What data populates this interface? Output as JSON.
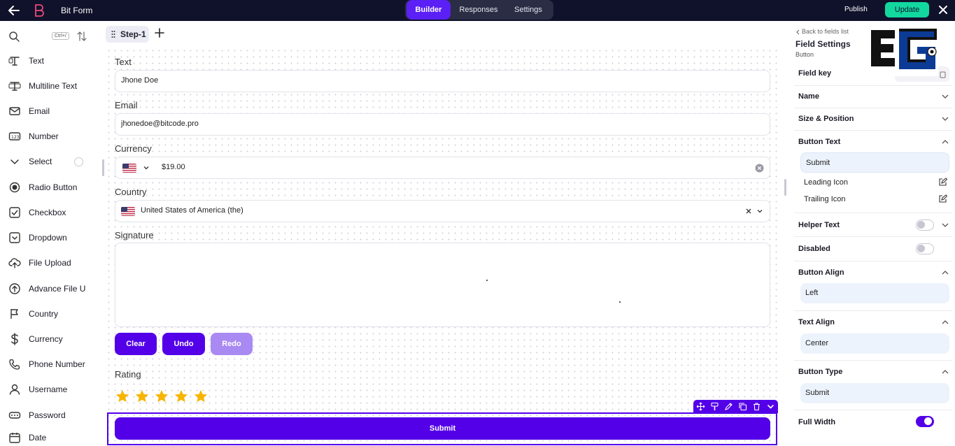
{
  "topbar": {
    "app_name": "Bit Form",
    "tabs": [
      {
        "label": "Builder",
        "active": true
      },
      {
        "label": "Responses",
        "active": false
      },
      {
        "label": "Settings",
        "active": false
      }
    ],
    "publish_label": "Publish",
    "update_label": "Update"
  },
  "sidebar": {
    "search_shortcut": "Ctrl+/",
    "items": [
      {
        "label": "Text",
        "icon": "text-icon"
      },
      {
        "label": "Multiline Text",
        "icon": "multiline-text-icon"
      },
      {
        "label": "Email",
        "icon": "email-icon"
      },
      {
        "label": "Number",
        "icon": "number-icon"
      },
      {
        "label": "Select",
        "icon": "chevron-down-icon"
      },
      {
        "label": "Radio Button",
        "icon": "radio-icon"
      },
      {
        "label": "Checkbox",
        "icon": "checkbox-icon"
      },
      {
        "label": "Dropdown",
        "icon": "dropdown-icon"
      },
      {
        "label": "File Upload",
        "icon": "upload-icon"
      },
      {
        "label": "Advance File U",
        "icon": "advance-upload-icon"
      },
      {
        "label": "Country",
        "icon": "flag-icon"
      },
      {
        "label": "Currency",
        "icon": "dollar-icon"
      },
      {
        "label": "Phone Number",
        "icon": "phone-icon"
      },
      {
        "label": "Username",
        "icon": "user-icon"
      },
      {
        "label": "Password",
        "icon": "key-icon"
      },
      {
        "label": "Date",
        "icon": "calendar-icon"
      }
    ]
  },
  "steps": {
    "current": "Step-1"
  },
  "form": {
    "text": {
      "label": "Text",
      "value": "Jhone Doe"
    },
    "email": {
      "label": "Email",
      "value": "jhonedoe@bitcode.pro"
    },
    "currency": {
      "label": "Currency",
      "value": "$19.00"
    },
    "country": {
      "label": "Country",
      "value": "United States of America (the)"
    },
    "signature": {
      "label": "Signature",
      "clear_label": "Clear",
      "undo_label": "Undo",
      "redo_label": "Redo"
    },
    "rating": {
      "label": "Rating",
      "stars": 5,
      "filled": 5
    },
    "submit_label": "Submit"
  },
  "settings_panel": {
    "back_label": "Back to fields list",
    "title": "Field Settings",
    "subtitle": "Button",
    "field_key_label": "Field key",
    "name_label": "Name",
    "size_position_label": "Size & Position",
    "button_text_label": "Button Text",
    "button_text_value": "Submit",
    "leading_icon_label": "Leading Icon",
    "trailing_icon_label": "Trailing Icon",
    "helper_text_label": "Helper Text",
    "helper_text_on": false,
    "disabled_label": "Disabled",
    "disabled_on": false,
    "button_align_label": "Button Align",
    "button_align_value": "Left",
    "text_align_label": "Text Align",
    "text_align_value": "Center",
    "button_type_label": "Button Type",
    "button_type_value": "Submit",
    "full_width_label": "Full Width",
    "full_width_on": true
  },
  "colors": {
    "primary": "#5300e8",
    "topbar_bg": "#10122b",
    "update_button": "#12d8a0",
    "star": "#f7b500"
  }
}
